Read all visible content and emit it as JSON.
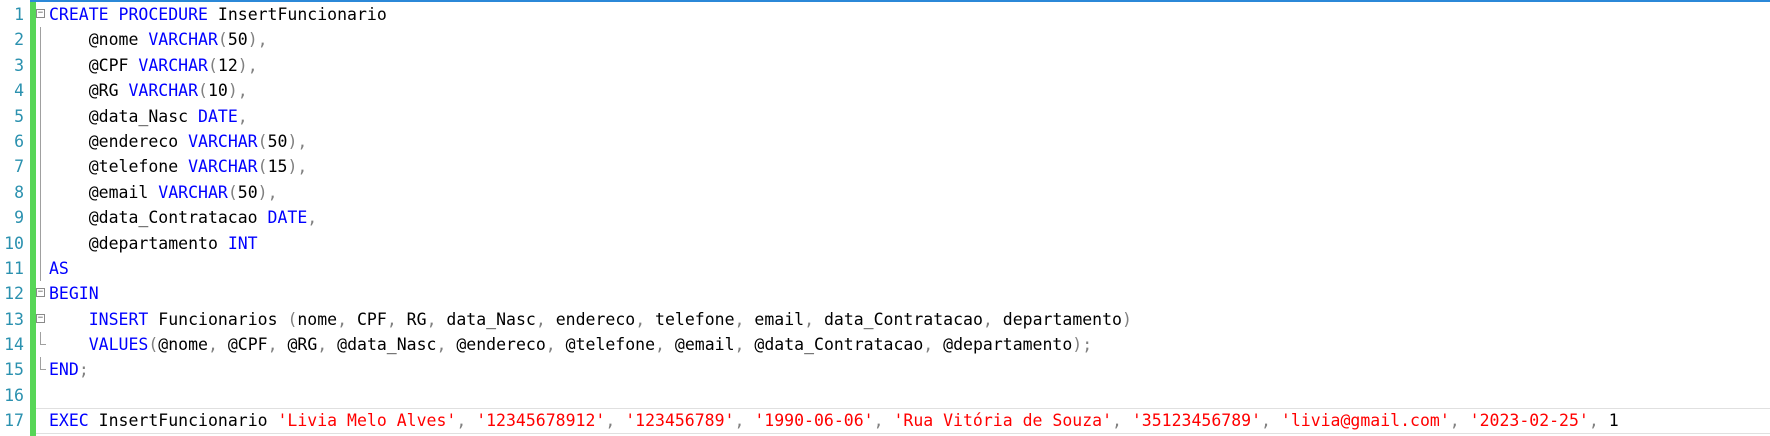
{
  "editor": {
    "lines": [
      {
        "n": "1",
        "fold": "minus",
        "tokens": [
          {
            "t": "kw",
            "v": "CREATE"
          },
          {
            "t": "plain",
            "v": " "
          },
          {
            "t": "kw",
            "v": "PROCEDURE"
          },
          {
            "t": "plain",
            "v": " InsertFuncionario"
          }
        ]
      },
      {
        "n": "2",
        "fold": "line",
        "tokens": [
          {
            "t": "plain",
            "v": "    @nome "
          },
          {
            "t": "kw",
            "v": "VARCHAR"
          },
          {
            "t": "gray",
            "v": "("
          },
          {
            "t": "plain",
            "v": "50"
          },
          {
            "t": "gray",
            "v": "),"
          }
        ]
      },
      {
        "n": "3",
        "fold": "line",
        "tokens": [
          {
            "t": "plain",
            "v": "    @CPF "
          },
          {
            "t": "kw",
            "v": "VARCHAR"
          },
          {
            "t": "gray",
            "v": "("
          },
          {
            "t": "plain",
            "v": "12"
          },
          {
            "t": "gray",
            "v": "),"
          }
        ]
      },
      {
        "n": "4",
        "fold": "line",
        "tokens": [
          {
            "t": "plain",
            "v": "    @RG "
          },
          {
            "t": "kw",
            "v": "VARCHAR"
          },
          {
            "t": "gray",
            "v": "("
          },
          {
            "t": "plain",
            "v": "10"
          },
          {
            "t": "gray",
            "v": "),"
          }
        ]
      },
      {
        "n": "5",
        "fold": "line",
        "tokens": [
          {
            "t": "plain",
            "v": "    @data_Nasc "
          },
          {
            "t": "kw",
            "v": "DATE"
          },
          {
            "t": "gray",
            "v": ","
          }
        ]
      },
      {
        "n": "6",
        "fold": "line",
        "tokens": [
          {
            "t": "plain",
            "v": "    @endereco "
          },
          {
            "t": "kw",
            "v": "VARCHAR"
          },
          {
            "t": "gray",
            "v": "("
          },
          {
            "t": "plain",
            "v": "50"
          },
          {
            "t": "gray",
            "v": "),"
          }
        ]
      },
      {
        "n": "7",
        "fold": "line",
        "tokens": [
          {
            "t": "plain",
            "v": "    @telefone "
          },
          {
            "t": "kw",
            "v": "VARCHAR"
          },
          {
            "t": "gray",
            "v": "("
          },
          {
            "t": "plain",
            "v": "15"
          },
          {
            "t": "gray",
            "v": "),"
          }
        ]
      },
      {
        "n": "8",
        "fold": "line",
        "tokens": [
          {
            "t": "plain",
            "v": "    @email "
          },
          {
            "t": "kw",
            "v": "VARCHAR"
          },
          {
            "t": "gray",
            "v": "("
          },
          {
            "t": "plain",
            "v": "50"
          },
          {
            "t": "gray",
            "v": "),"
          }
        ]
      },
      {
        "n": "9",
        "fold": "line",
        "tokens": [
          {
            "t": "plain",
            "v": "    @data_Contratacao "
          },
          {
            "t": "kw",
            "v": "DATE"
          },
          {
            "t": "gray",
            "v": ","
          }
        ]
      },
      {
        "n": "10",
        "fold": "line",
        "tokens": [
          {
            "t": "plain",
            "v": "    @departamento "
          },
          {
            "t": "kw",
            "v": "INT"
          }
        ]
      },
      {
        "n": "11",
        "fold": "line",
        "tokens": [
          {
            "t": "kw",
            "v": "AS"
          }
        ]
      },
      {
        "n": "12",
        "fold": "minus",
        "tokens": [
          {
            "t": "kw",
            "v": "BEGIN"
          }
        ]
      },
      {
        "n": "13",
        "fold": "minus",
        "tokens": [
          {
            "t": "plain",
            "v": "    "
          },
          {
            "t": "kw",
            "v": "INSERT"
          },
          {
            "t": "plain",
            "v": " Funcionarios "
          },
          {
            "t": "gray",
            "v": "("
          },
          {
            "t": "plain",
            "v": "nome"
          },
          {
            "t": "gray",
            "v": ","
          },
          {
            "t": "plain",
            "v": " CPF"
          },
          {
            "t": "gray",
            "v": ","
          },
          {
            "t": "plain",
            "v": " RG"
          },
          {
            "t": "gray",
            "v": ","
          },
          {
            "t": "plain",
            "v": " data_Nasc"
          },
          {
            "t": "gray",
            "v": ","
          },
          {
            "t": "plain",
            "v": " endereco"
          },
          {
            "t": "gray",
            "v": ","
          },
          {
            "t": "plain",
            "v": " telefone"
          },
          {
            "t": "gray",
            "v": ","
          },
          {
            "t": "plain",
            "v": " email"
          },
          {
            "t": "gray",
            "v": ","
          },
          {
            "t": "plain",
            "v": " data_Contratacao"
          },
          {
            "t": "gray",
            "v": ","
          },
          {
            "t": "plain",
            "v": " departamento"
          },
          {
            "t": "gray",
            "v": ")"
          }
        ]
      },
      {
        "n": "14",
        "fold": "end",
        "tokens": [
          {
            "t": "plain",
            "v": "    "
          },
          {
            "t": "kw",
            "v": "VALUES"
          },
          {
            "t": "gray",
            "v": "("
          },
          {
            "t": "plain",
            "v": "@nome"
          },
          {
            "t": "gray",
            "v": ","
          },
          {
            "t": "plain",
            "v": " @CPF"
          },
          {
            "t": "gray",
            "v": ","
          },
          {
            "t": "plain",
            "v": " @RG"
          },
          {
            "t": "gray",
            "v": ","
          },
          {
            "t": "plain",
            "v": " @data_Nasc"
          },
          {
            "t": "gray",
            "v": ","
          },
          {
            "t": "plain",
            "v": " @endereco"
          },
          {
            "t": "gray",
            "v": ","
          },
          {
            "t": "plain",
            "v": " @telefone"
          },
          {
            "t": "gray",
            "v": ","
          },
          {
            "t": "plain",
            "v": " @email"
          },
          {
            "t": "gray",
            "v": ","
          },
          {
            "t": "plain",
            "v": " @data_Contratacao"
          },
          {
            "t": "gray",
            "v": ","
          },
          {
            "t": "plain",
            "v": " @departamento"
          },
          {
            "t": "gray",
            "v": ");"
          }
        ]
      },
      {
        "n": "15",
        "fold": "end",
        "tokens": [
          {
            "t": "kw",
            "v": "END"
          },
          {
            "t": "gray",
            "v": ";"
          }
        ]
      },
      {
        "n": "16",
        "fold": "none",
        "tokens": []
      },
      {
        "n": "17",
        "fold": "none",
        "caret": true,
        "tokens": [
          {
            "t": "kw",
            "v": "EXEC"
          },
          {
            "t": "plain",
            "v": " InsertFuncionario "
          },
          {
            "t": "str",
            "v": "'Livia Melo Alves'"
          },
          {
            "t": "gray",
            "v": ","
          },
          {
            "t": "plain",
            "v": " "
          },
          {
            "t": "str",
            "v": "'12345678912'"
          },
          {
            "t": "gray",
            "v": ","
          },
          {
            "t": "plain",
            "v": " "
          },
          {
            "t": "str",
            "v": "'123456789'"
          },
          {
            "t": "gray",
            "v": ","
          },
          {
            "t": "plain",
            "v": " "
          },
          {
            "t": "str",
            "v": "'1990-06-06'"
          },
          {
            "t": "gray",
            "v": ","
          },
          {
            "t": "plain",
            "v": " "
          },
          {
            "t": "str",
            "v": "'Rua Vitória de Souza'"
          },
          {
            "t": "gray",
            "v": ","
          },
          {
            "t": "plain",
            "v": " "
          },
          {
            "t": "str",
            "v": "'35123456789'"
          },
          {
            "t": "gray",
            "v": ","
          },
          {
            "t": "plain",
            "v": " "
          },
          {
            "t": "str",
            "v": "'livia@gmail.com'"
          },
          {
            "t": "gray",
            "v": ","
          },
          {
            "t": "plain",
            "v": " "
          },
          {
            "t": "str",
            "v": "'2023-02-25'"
          },
          {
            "t": "gray",
            "v": ","
          },
          {
            "t": "plain",
            "v": " 1"
          }
        ]
      }
    ],
    "colors": {
      "keyword": "#0000ff",
      "string": "#ff0000",
      "punct": "#808080",
      "linenum": "#2b91af",
      "changebar": "#57d657"
    },
    "fold_icon": "minus-box-icon"
  }
}
